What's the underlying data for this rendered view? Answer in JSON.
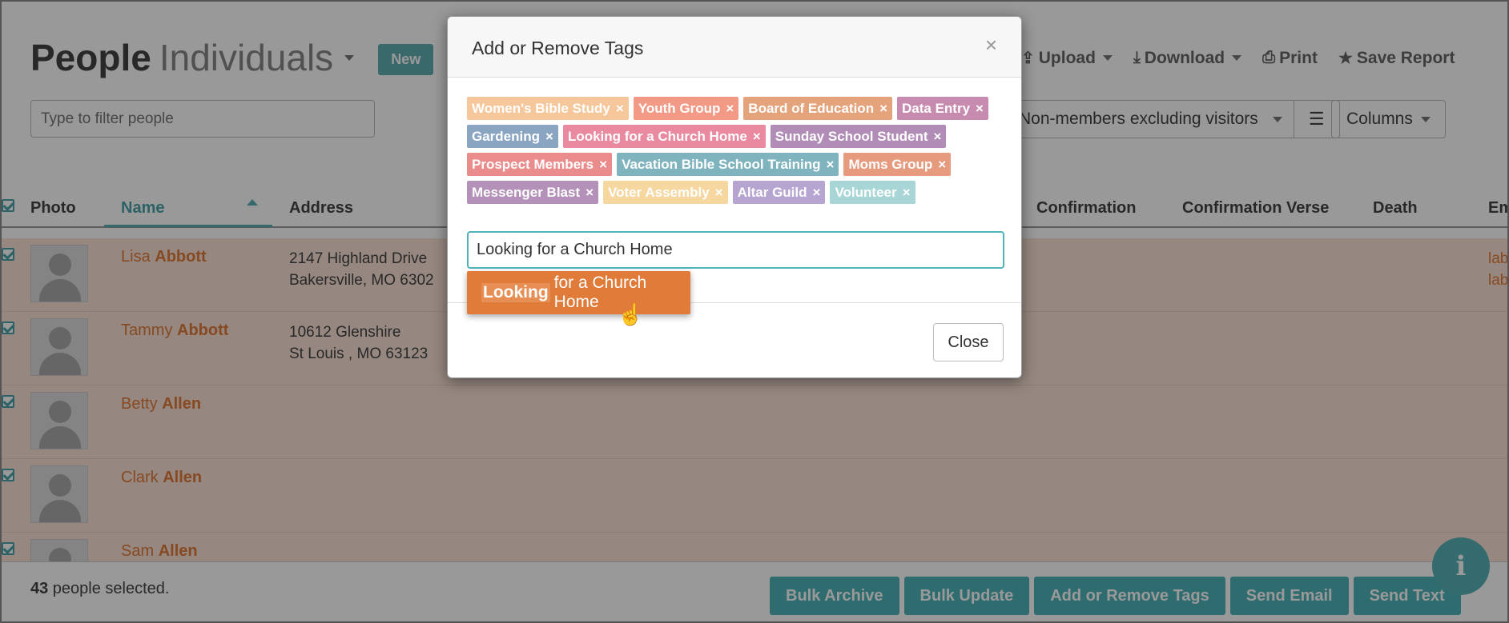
{
  "header": {
    "title": "People",
    "subtitle": "Individuals",
    "new_label": "New",
    "filter_placeholder": "Type to filter people"
  },
  "toolbar": {
    "upload": "Upload",
    "download": "Download",
    "print": "Print",
    "save_report": "Save Report"
  },
  "filters": {
    "segment": "Non-members excluding visitors",
    "columns": "Columns"
  },
  "table": {
    "columns": [
      "Photo",
      "Name",
      "Address",
      "Confirmation",
      "Confirmation Verse",
      "Death",
      "Em"
    ],
    "rows": [
      {
        "first": "Lisa",
        "last": "Abbott",
        "addr1": "2147 Highland Drive",
        "addr2": "Bakersville, MO   6302",
        "email1": "lab",
        "email2": "lab"
      },
      {
        "first": "Tammy",
        "last": "Abbott",
        "addr1": "10612 Glenshire",
        "addr2": "St Louis , MO   63123",
        "email1": "",
        "email2": ""
      },
      {
        "first": "Betty",
        "last": "Allen",
        "addr1": "",
        "addr2": "",
        "email1": "",
        "email2": ""
      },
      {
        "first": "Clark",
        "last": "Allen",
        "addr1": "",
        "addr2": "",
        "email1": "",
        "email2": ""
      },
      {
        "first": "Sam",
        "last": "Allen",
        "addr1": "",
        "addr2": "",
        "email1": "",
        "email2": ""
      }
    ]
  },
  "bottom": {
    "count": "43",
    "count_suffix": " people selected.",
    "buttons": [
      "Bulk Archive",
      "Bulk Update",
      "Add or Remove Tags",
      "Send Email",
      "Send Text"
    ]
  },
  "modal": {
    "title": "Add or Remove Tags",
    "close_x": "×",
    "tags": [
      {
        "label": "Women's Bible Study",
        "color": "#f6c79a"
      },
      {
        "label": "Youth Group",
        "color": "#f29a86"
      },
      {
        "label": "Board of Education",
        "color": "#e4a37a"
      },
      {
        "label": "Data Entry",
        "color": "#c88bb0"
      },
      {
        "label": "Gardening",
        "color": "#8aa5c2"
      },
      {
        "label": "Looking for a Church Home",
        "color": "#e98aa0"
      },
      {
        "label": "Sunday School Student",
        "color": "#b08cb6"
      },
      {
        "label": "Prospect Members",
        "color": "#ea8c8c"
      },
      {
        "label": "Vacation Bible School Training",
        "color": "#7fb3be"
      },
      {
        "label": "Moms Group",
        "color": "#e69a7e"
      },
      {
        "label": "Messenger Blast",
        "color": "#b491b8"
      },
      {
        "label": "Voter Assembly",
        "color": "#f6d7a0"
      },
      {
        "label": "Altar Guild",
        "color": "#b6a5d0"
      },
      {
        "label": "Volunteer",
        "color": "#a8d6d6"
      }
    ],
    "input_value": "Looking for a Church Home",
    "suggestion_match": "Looking",
    "suggestion_rest": "for a Church Home",
    "close_label": "Close"
  },
  "icons": {
    "upload": "upload-icon",
    "download": "download-icon",
    "print": "print-icon",
    "save": "star-icon",
    "info": "info-icon",
    "menu": "hamburger-icon"
  },
  "colors": {
    "accent": "#4db4b9",
    "orange": "#e07b39",
    "row_bg": "#fbe3d6"
  }
}
